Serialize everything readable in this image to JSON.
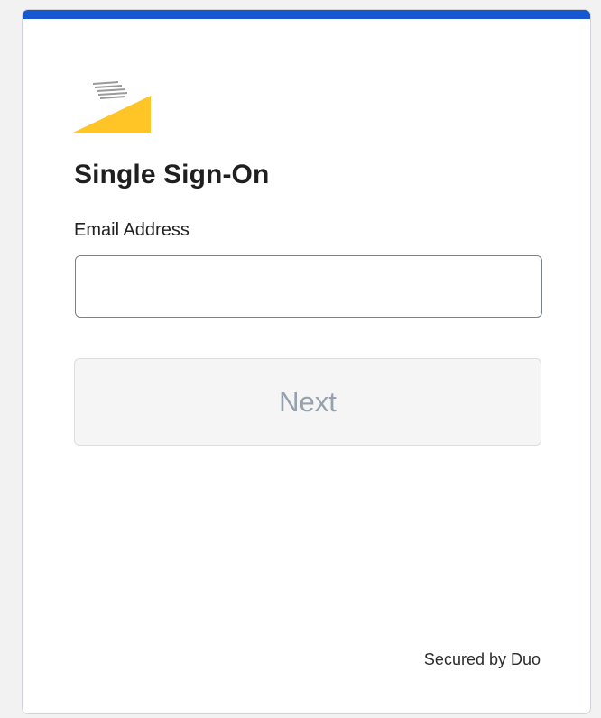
{
  "page": {
    "title": "Single Sign-On",
    "accent_color": "#1757d0"
  },
  "logo": {
    "icon": "yellow-wedge-logo",
    "colors": {
      "wedge": "#ffc526",
      "stripes": "#9a9a9a"
    }
  },
  "form": {
    "email_label": "Email Address",
    "email_value": "",
    "email_placeholder": "",
    "next_label": "Next",
    "next_disabled": true
  },
  "footer": {
    "secured_by": "Secured by Duo"
  }
}
